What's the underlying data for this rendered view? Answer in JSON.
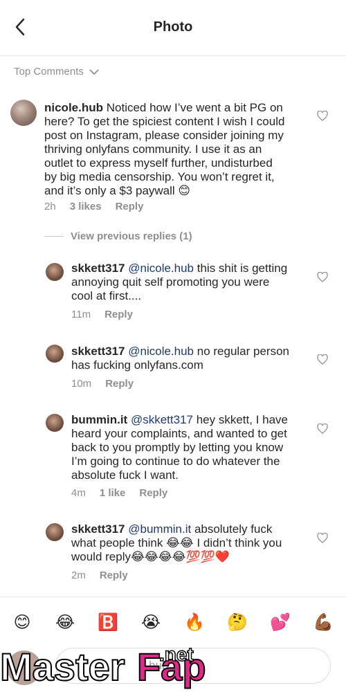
{
  "header": {
    "title": "Photo"
  },
  "sort": {
    "label": "Top Comments"
  },
  "main_comment": {
    "user": "nicole.hub",
    "lines": [
      "Noticed how I’ve went a bit PG on",
      "here? To get the spiciest content I wish I could",
      "post on Instagram, please consider joining my",
      "thriving onlyfans community. I use it as an",
      "outlet to express myself further, undisturbed",
      "by big media censorship. You won’t regret it,",
      "and it’s only a $3 paywall 😊"
    ],
    "time": "2h",
    "likes": "3 likes",
    "reply": "Reply"
  },
  "view_previous": "View previous replies (1)",
  "replies": [
    {
      "user": "skkett317",
      "mention": "@nicole.hub",
      "first": "this shit is getting",
      "lines": [
        "annoying quit self promoting you were",
        "cool at first...."
      ],
      "time": "11m",
      "likes": "",
      "reply": "Reply"
    },
    {
      "user": "skkett317",
      "mention": "@nicole.hub",
      "first": "no regular person",
      "lines": [
        "has fucking onlyfans.com"
      ],
      "time": "10m",
      "likes": "",
      "reply": "Reply"
    },
    {
      "user": "bummin.it",
      "mention": "@skkett317",
      "first": "hey skkett, I have",
      "lines": [
        "heard your complaints, and wanted to get",
        "back to you promptly by letting you know",
        "I’m going to continue to do whatever the",
        "absolute fuck I want."
      ],
      "time": "4m",
      "likes": "1 like",
      "reply": "Reply"
    },
    {
      "user": "skkett317",
      "mention": "@bummin.it",
      "first": "absolutely fuck",
      "lines": [
        "what people think 😂😂 I didn’t think you",
        "would reply😂😂😂😂💯💯❤️"
      ],
      "time": "2m",
      "likes": "",
      "reply": "Reply"
    }
  ],
  "emojis": [
    "😊",
    "😂",
    "🅱️",
    "😭",
    "🔥",
    "🤔",
    "💕",
    "💪🏾"
  ],
  "input": {
    "placeholder": "...hub..."
  },
  "watermark": {
    "left": "Master",
    "right": "Fap",
    "suffix": ".net"
  }
}
